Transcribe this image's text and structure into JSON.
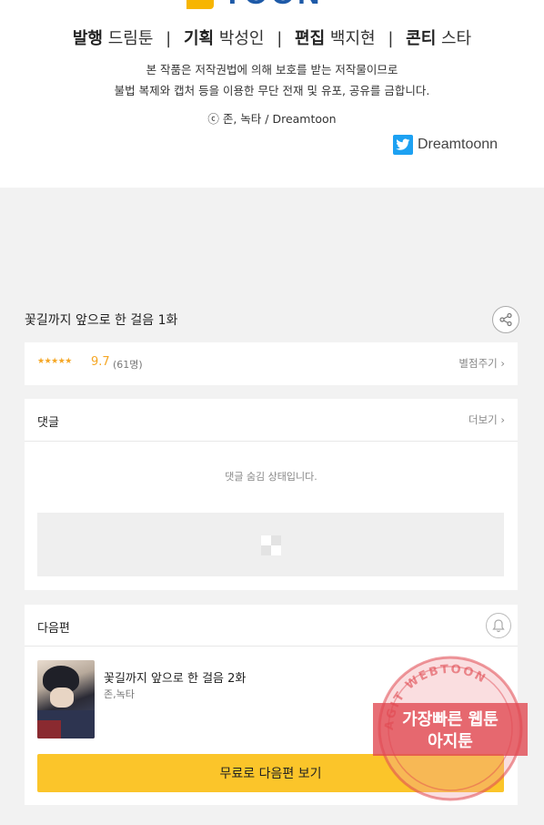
{
  "header": {
    "logo_text": "TOON",
    "credits": [
      {
        "role": "발행",
        "name": "드림툰"
      },
      {
        "role": "기획",
        "name": "박성인"
      },
      {
        "role": "편집",
        "name": "백지현"
      },
      {
        "role": "콘티",
        "name": "스타"
      }
    ],
    "notice_line1": "본 작품은 저작권법에 의해 보호를 받는 저작물이므로",
    "notice_line2": "불법 복제와 캡처 등을 이용한 무단 전재 및 유포, 공유를 금합니다.",
    "copyright": "ⓒ 존, 녹타 / Dreamtoon",
    "twitter_handle": "Dreamtoonn"
  },
  "episode": {
    "title": "꽃길까지 앞으로 한 걸음 1화",
    "stars": "★★★★★",
    "score": "9.7",
    "rating_count": "(61명)",
    "rate_link": "별점주기 ›"
  },
  "comments": {
    "title": "댓글",
    "more_link": "더보기 ›",
    "hidden_message": "댓글 숨김 상태입니다."
  },
  "next": {
    "section_title": "다음편",
    "episode_title": "꽃길까지 앞으로 한 걸음 2화",
    "author": "존,녹타",
    "button_label": "무료로 다음편 보기"
  },
  "watermark": {
    "arc_text": "AGIT WEBTOON",
    "line1": "가장빠른 웹툰",
    "line2": "아지툰"
  },
  "colors": {
    "accent_yellow": "#fbc52a",
    "star_orange": "#f5a623",
    "twitter_blue": "#1da1f2",
    "stamp_red": "#e0474f"
  }
}
